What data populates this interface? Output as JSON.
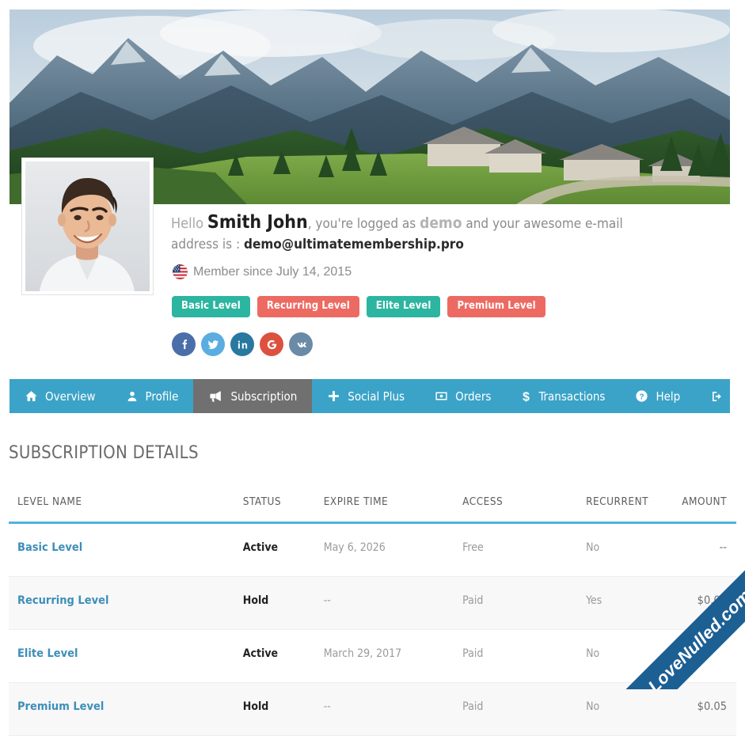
{
  "cover": {
    "alt": "mountain-landscape-cover"
  },
  "avatar": {
    "alt": "member-portrait-photo"
  },
  "greeting": {
    "hello": "Hello",
    "name": "Smith John",
    "mid": ", you're logged as",
    "username": "demo",
    "tail": "and your awesome e-mail",
    "address_label": "address is :",
    "email": "demo@ultimatemembership.pro"
  },
  "member_since": {
    "flag": "us-flag-icon",
    "text": "Member since July 14, 2015"
  },
  "levels": [
    {
      "label": "Basic Level",
      "color": "#2cb5a0"
    },
    {
      "label": "Recurring Level",
      "color": "#ed6a62"
    },
    {
      "label": "Elite Level",
      "color": "#2cb5a0"
    },
    {
      "label": "Premium Level",
      "color": "#ed6a62"
    }
  ],
  "socials": [
    {
      "name": "facebook-icon",
      "color": "#4a6ea9"
    },
    {
      "name": "twitter-icon",
      "color": "#5aade0"
    },
    {
      "name": "linkedin-icon",
      "color": "#2878a0"
    },
    {
      "name": "google-icon",
      "color": "#dd5040"
    },
    {
      "name": "vk-icon",
      "color": "#6a8ba8"
    }
  ],
  "nav": {
    "bar_color": "#3ba3c8",
    "active_color": "#707070",
    "items": [
      {
        "label": "Overview",
        "icon": "home-icon",
        "active": false
      },
      {
        "label": "Profile",
        "icon": "user-icon",
        "active": false
      },
      {
        "label": "Subscription",
        "icon": "megaphone-icon",
        "active": true
      },
      {
        "label": "Social Plus",
        "icon": "plus-icon",
        "active": false
      },
      {
        "label": "Orders",
        "icon": "banknote-icon",
        "active": false
      },
      {
        "label": "Transactions",
        "icon": "dollar-icon",
        "active": false
      },
      {
        "label": "Help",
        "icon": "question-circle-icon",
        "active": false
      },
      {
        "label": "",
        "icon": "logout-icon",
        "active": false
      }
    ]
  },
  "section": {
    "title": "SUBSCRIPTION DETAILS",
    "accent": "#4fb3dd"
  },
  "table": {
    "headers": [
      "LEVEL NAME",
      "STATUS",
      "EXPIRE TIME",
      "ACCESS",
      "RECURRENT",
      "AMOUNT"
    ],
    "rows": [
      {
        "level": "Basic Level",
        "status": "Active",
        "expire": "May 6, 2026",
        "access": "Free",
        "recurrent": "No",
        "amount": "--"
      },
      {
        "level": "Recurring Level",
        "status": "Hold",
        "expire": "--",
        "access": "Paid",
        "recurrent": "Yes",
        "amount": "$0.01"
      },
      {
        "level": "Elite Level",
        "status": "Active",
        "expire": "March 29, 2017",
        "access": "Paid",
        "recurrent": "No",
        "amount": ""
      },
      {
        "level": "Premium Level",
        "status": "Hold",
        "expire": "--",
        "access": "Paid",
        "recurrent": "No",
        "amount": "$0.05"
      }
    ]
  },
  "watermark": {
    "text": "LoveNulled.com",
    "heart": "♥",
    "color": "#1c5f93",
    "heart_color": "#e8192c"
  }
}
